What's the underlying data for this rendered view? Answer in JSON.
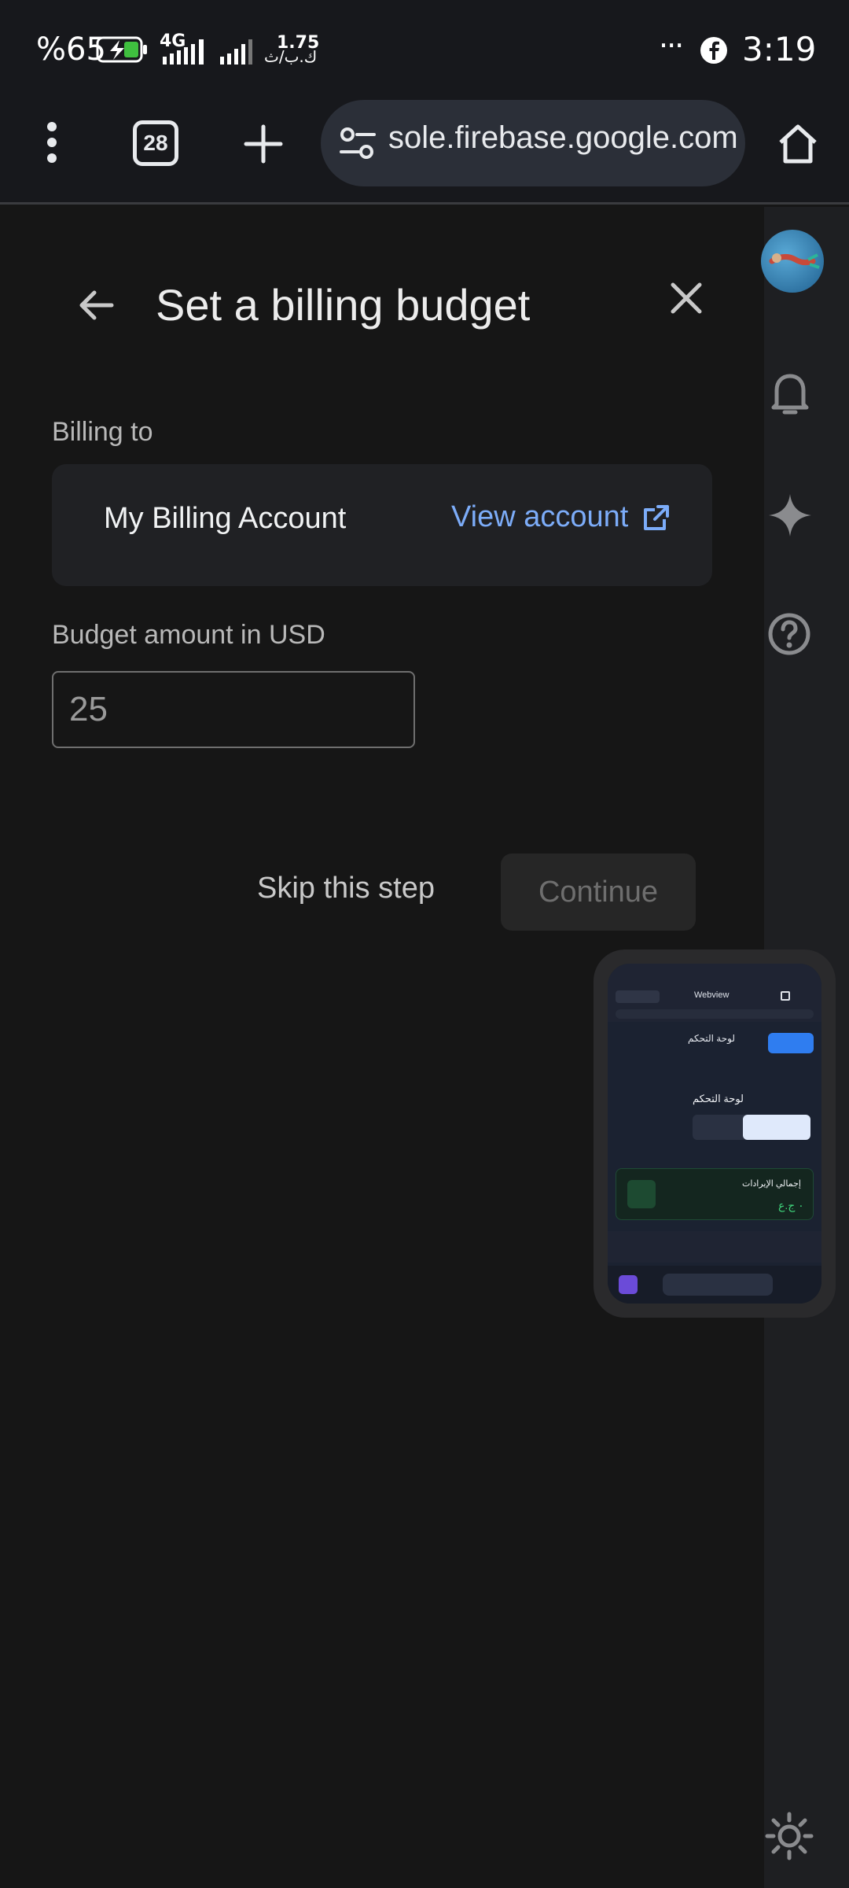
{
  "status_bar": {
    "battery": "%65",
    "network": "4G",
    "speed": "1.75",
    "speed_unit": "ك.ب/ث",
    "overflow": "···",
    "time": "3:19"
  },
  "browser": {
    "tabs_count": "28",
    "url": "sole.firebase.google.com"
  },
  "dialog": {
    "title": "Set a billing budget",
    "billing_to_label": "Billing to",
    "account_name": "My Billing Account",
    "view_account_label": "View account",
    "budget_label": "Budget amount in USD",
    "budget_value": "25",
    "skip_label": "Skip this step",
    "continue_label": "Continue"
  },
  "thumbnail": {
    "app_name": "Webview",
    "page_title": "لوحة التحكم",
    "section_title": "لوحة التحكم",
    "revenue_label": "إجمالي الإيرادات",
    "revenue_value": "٠ ج.ع"
  },
  "colors": {
    "accent_link": "#7cacf8",
    "background": "#161616"
  }
}
